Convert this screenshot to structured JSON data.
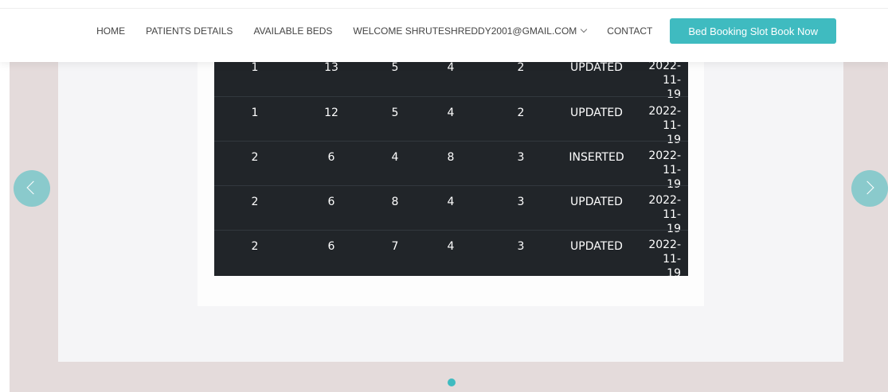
{
  "navbar": {
    "links": [
      "HOME",
      "PATIENTS DETAILS",
      "AVAILABLE BEDS",
      "WELCOME SHRUTESHREDDY2001@GMAIL.COM",
      "CONTACT"
    ],
    "cta_label": "Bed Booking Slot Book Now"
  },
  "table": {
    "rows": [
      [
        "1",
        "13",
        "5",
        "4",
        "2",
        "UPDATED",
        "2022-11-19"
      ],
      [
        "1",
        "12",
        "5",
        "4",
        "2",
        "UPDATED",
        "2022-11-19"
      ],
      [
        "2",
        "6",
        "4",
        "8",
        "3",
        "INSERTED",
        "2022-11-19"
      ],
      [
        "2",
        "6",
        "8",
        "4",
        "3",
        "UPDATED",
        "2022-11-19"
      ],
      [
        "2",
        "6",
        "7",
        "4",
        "3",
        "UPDATED",
        "2022-11-19"
      ]
    ]
  },
  "colors": {
    "accent": "#3fbbc0",
    "table_bg": "#212529",
    "hero_bg": "#e4dbdb"
  },
  "icons": {
    "prev": "chevron-left-icon",
    "next": "chevron-right-icon",
    "dropdown": "chevron-down-icon"
  }
}
